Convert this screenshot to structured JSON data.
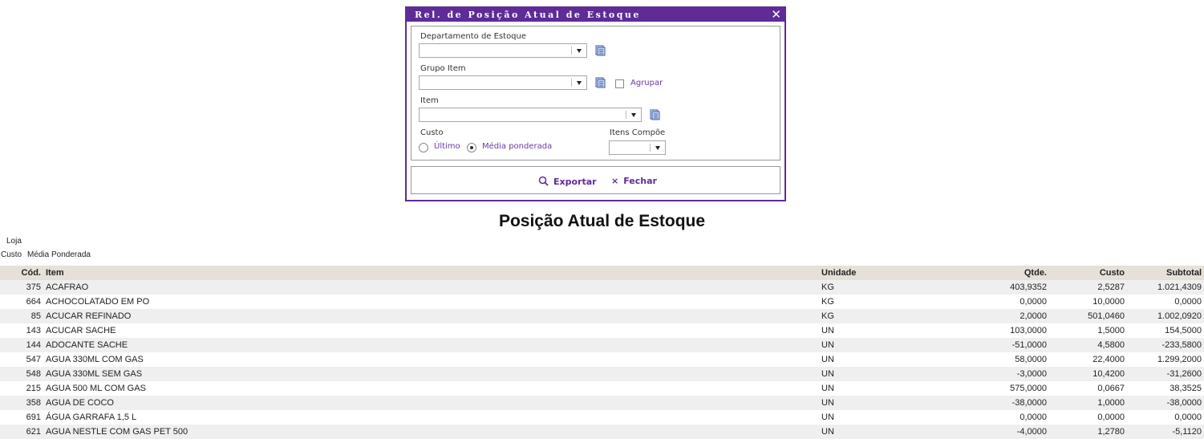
{
  "dialog": {
    "title": "Rel. de Posição Atual de Estoque",
    "close_glyph": "✕",
    "fields": {
      "departamento_label": "Departamento de Estoque",
      "grupo_label": "Grupo Item",
      "agrupar_label": "Agrupar",
      "item_label": "Item",
      "custo_label": "Custo",
      "custo_option_ultimo": "Último",
      "custo_option_media": "Média ponderada",
      "custo_selected": "Média ponderada",
      "itens_compoe_label": "Itens Compõe"
    },
    "actions": {
      "exportar_label": "Exportar",
      "fechar_label": "Fechar",
      "fechar_glyph": "×"
    },
    "colors": {
      "accent": "#5e2b97"
    }
  },
  "report": {
    "title": "Posição Atual de Estoque",
    "loja_label": "Loja",
    "custo_label": "Custo",
    "custo_value": "Média Ponderada",
    "columns": {
      "cod": "Cód.",
      "item": "Item",
      "unidade": "Unidade",
      "qtde": "Qtde.",
      "custo": "Custo",
      "subtotal": "Subtotal"
    },
    "rows": [
      {
        "cod": "375",
        "item": "ACAFRAO",
        "unidade": "KG",
        "qtde": "403,9352",
        "custo": "2,5287",
        "subtotal": "1.021,4309"
      },
      {
        "cod": "664",
        "item": "ACHOCOLATADO EM PO",
        "unidade": "KG",
        "qtde": "0,0000",
        "custo": "10,0000",
        "subtotal": "0,0000"
      },
      {
        "cod": "85",
        "item": "ACUCAR REFINADO",
        "unidade": "KG",
        "qtde": "2,0000",
        "custo": "501,0460",
        "subtotal": "1.002,0920"
      },
      {
        "cod": "143",
        "item": "ACUCAR SACHE",
        "unidade": "UN",
        "qtde": "103,0000",
        "custo": "1,5000",
        "subtotal": "154,5000"
      },
      {
        "cod": "144",
        "item": "ADOCANTE SACHE",
        "unidade": "UN",
        "qtde": "-51,0000",
        "custo": "4,5800",
        "subtotal": "-233,5800"
      },
      {
        "cod": "547",
        "item": "AGUA 330ML COM GAS",
        "unidade": "UN",
        "qtde": "58,0000",
        "custo": "22,4000",
        "subtotal": "1.299,2000"
      },
      {
        "cod": "548",
        "item": "AGUA 330ML SEM GAS",
        "unidade": "UN",
        "qtde": "-3,0000",
        "custo": "10,4200",
        "subtotal": "-31,2600"
      },
      {
        "cod": "215",
        "item": "AGUA 500 ML COM GAS",
        "unidade": "UN",
        "qtde": "575,0000",
        "custo": "0,0667",
        "subtotal": "38,3525"
      },
      {
        "cod": "358",
        "item": "AGUA DE COCO",
        "unidade": "UN",
        "qtde": "-38,0000",
        "custo": "1,0000",
        "subtotal": "-38,0000"
      },
      {
        "cod": "691",
        "item": "ÁGUA GARRAFA 1,5 L",
        "unidade": "UN",
        "qtde": "0,0000",
        "custo": "0,0000",
        "subtotal": "0,0000"
      },
      {
        "cod": "621",
        "item": "AGUA NESTLE COM GAS PET 500",
        "unidade": "UN",
        "qtde": "-4,0000",
        "custo": "1,2780",
        "subtotal": "-5,1120"
      }
    ]
  }
}
